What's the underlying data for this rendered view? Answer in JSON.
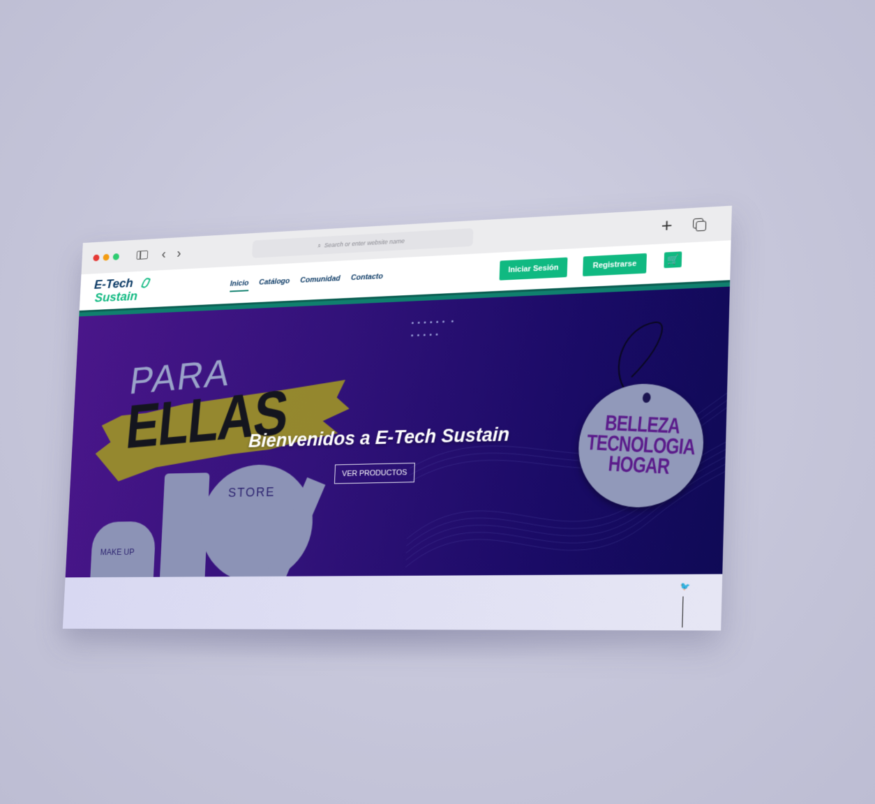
{
  "browser": {
    "url_placeholder": "Search or enter website name",
    "search_glyph": "⌕",
    "back_glyph": "‹",
    "forward_glyph": "›",
    "new_tab_glyph": "+"
  },
  "site": {
    "logo_line1": "E-Tech",
    "logo_line2": "Sustain",
    "nav": [
      "Inicio",
      "Catálogo",
      "Comunidad",
      "Contacto"
    ],
    "login_label": "Iniciar Sesión",
    "register_label": "Registrarse",
    "cart_glyph": "🛒"
  },
  "hero": {
    "para": "PARA",
    "ellas": "ELLAS",
    "title": "Bienvenidos a E-Tech Sustain",
    "button": "VER PRODUCTOS",
    "store_label": "STORE",
    "makeup_label": "MAKE UP",
    "tag_lines": [
      "BELLEZA",
      "TECNOLOGIA",
      "HOGAR"
    ]
  },
  "footer": {
    "twitter_glyph": "🐦"
  },
  "colors": {
    "accent_green": "#10b981",
    "brand_blue": "#0d3b66",
    "hero_purple": "#32127a"
  }
}
